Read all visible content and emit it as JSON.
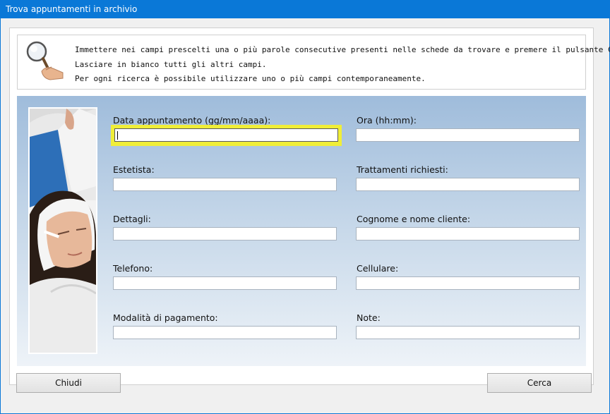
{
  "window": {
    "title": "Trova appuntamenti in archivio"
  },
  "info": {
    "icon": "magnifier-hand-icon",
    "lines": [
      "Immettere nei campi prescelti una o più parole consecutive presenti nelle schede da trovare e premere il pulsante Cerca.",
      "Lasciare in bianco tutti gli altri campi.",
      "Per ogni ricerca è possibile utilizzare uno o più campi contemporaneamente."
    ]
  },
  "form": {
    "fields": [
      {
        "label": "Data appuntamento (gg/mm/aaaa):",
        "value": ""
      },
      {
        "label": "Ora (hh:mm):",
        "value": ""
      },
      {
        "label": "Estetista:",
        "value": ""
      },
      {
        "label": "Trattamenti richiesti:",
        "value": ""
      },
      {
        "label": "Dettagli:",
        "value": ""
      },
      {
        "label": "Cognome e nome cliente:",
        "value": ""
      },
      {
        "label": "Telefono:",
        "value": ""
      },
      {
        "label": "Cellulare:",
        "value": ""
      },
      {
        "label": "Modalità di pagamento:",
        "value": ""
      },
      {
        "label": "Note:",
        "value": ""
      }
    ],
    "focus_color": "#f0ee37"
  },
  "buttons": {
    "close": "Chiudi",
    "search": "Cerca"
  },
  "colors": {
    "titlebar": "#0a78d7",
    "panel_top": "#9fbcdb",
    "panel_bottom": "#eef3f8"
  }
}
